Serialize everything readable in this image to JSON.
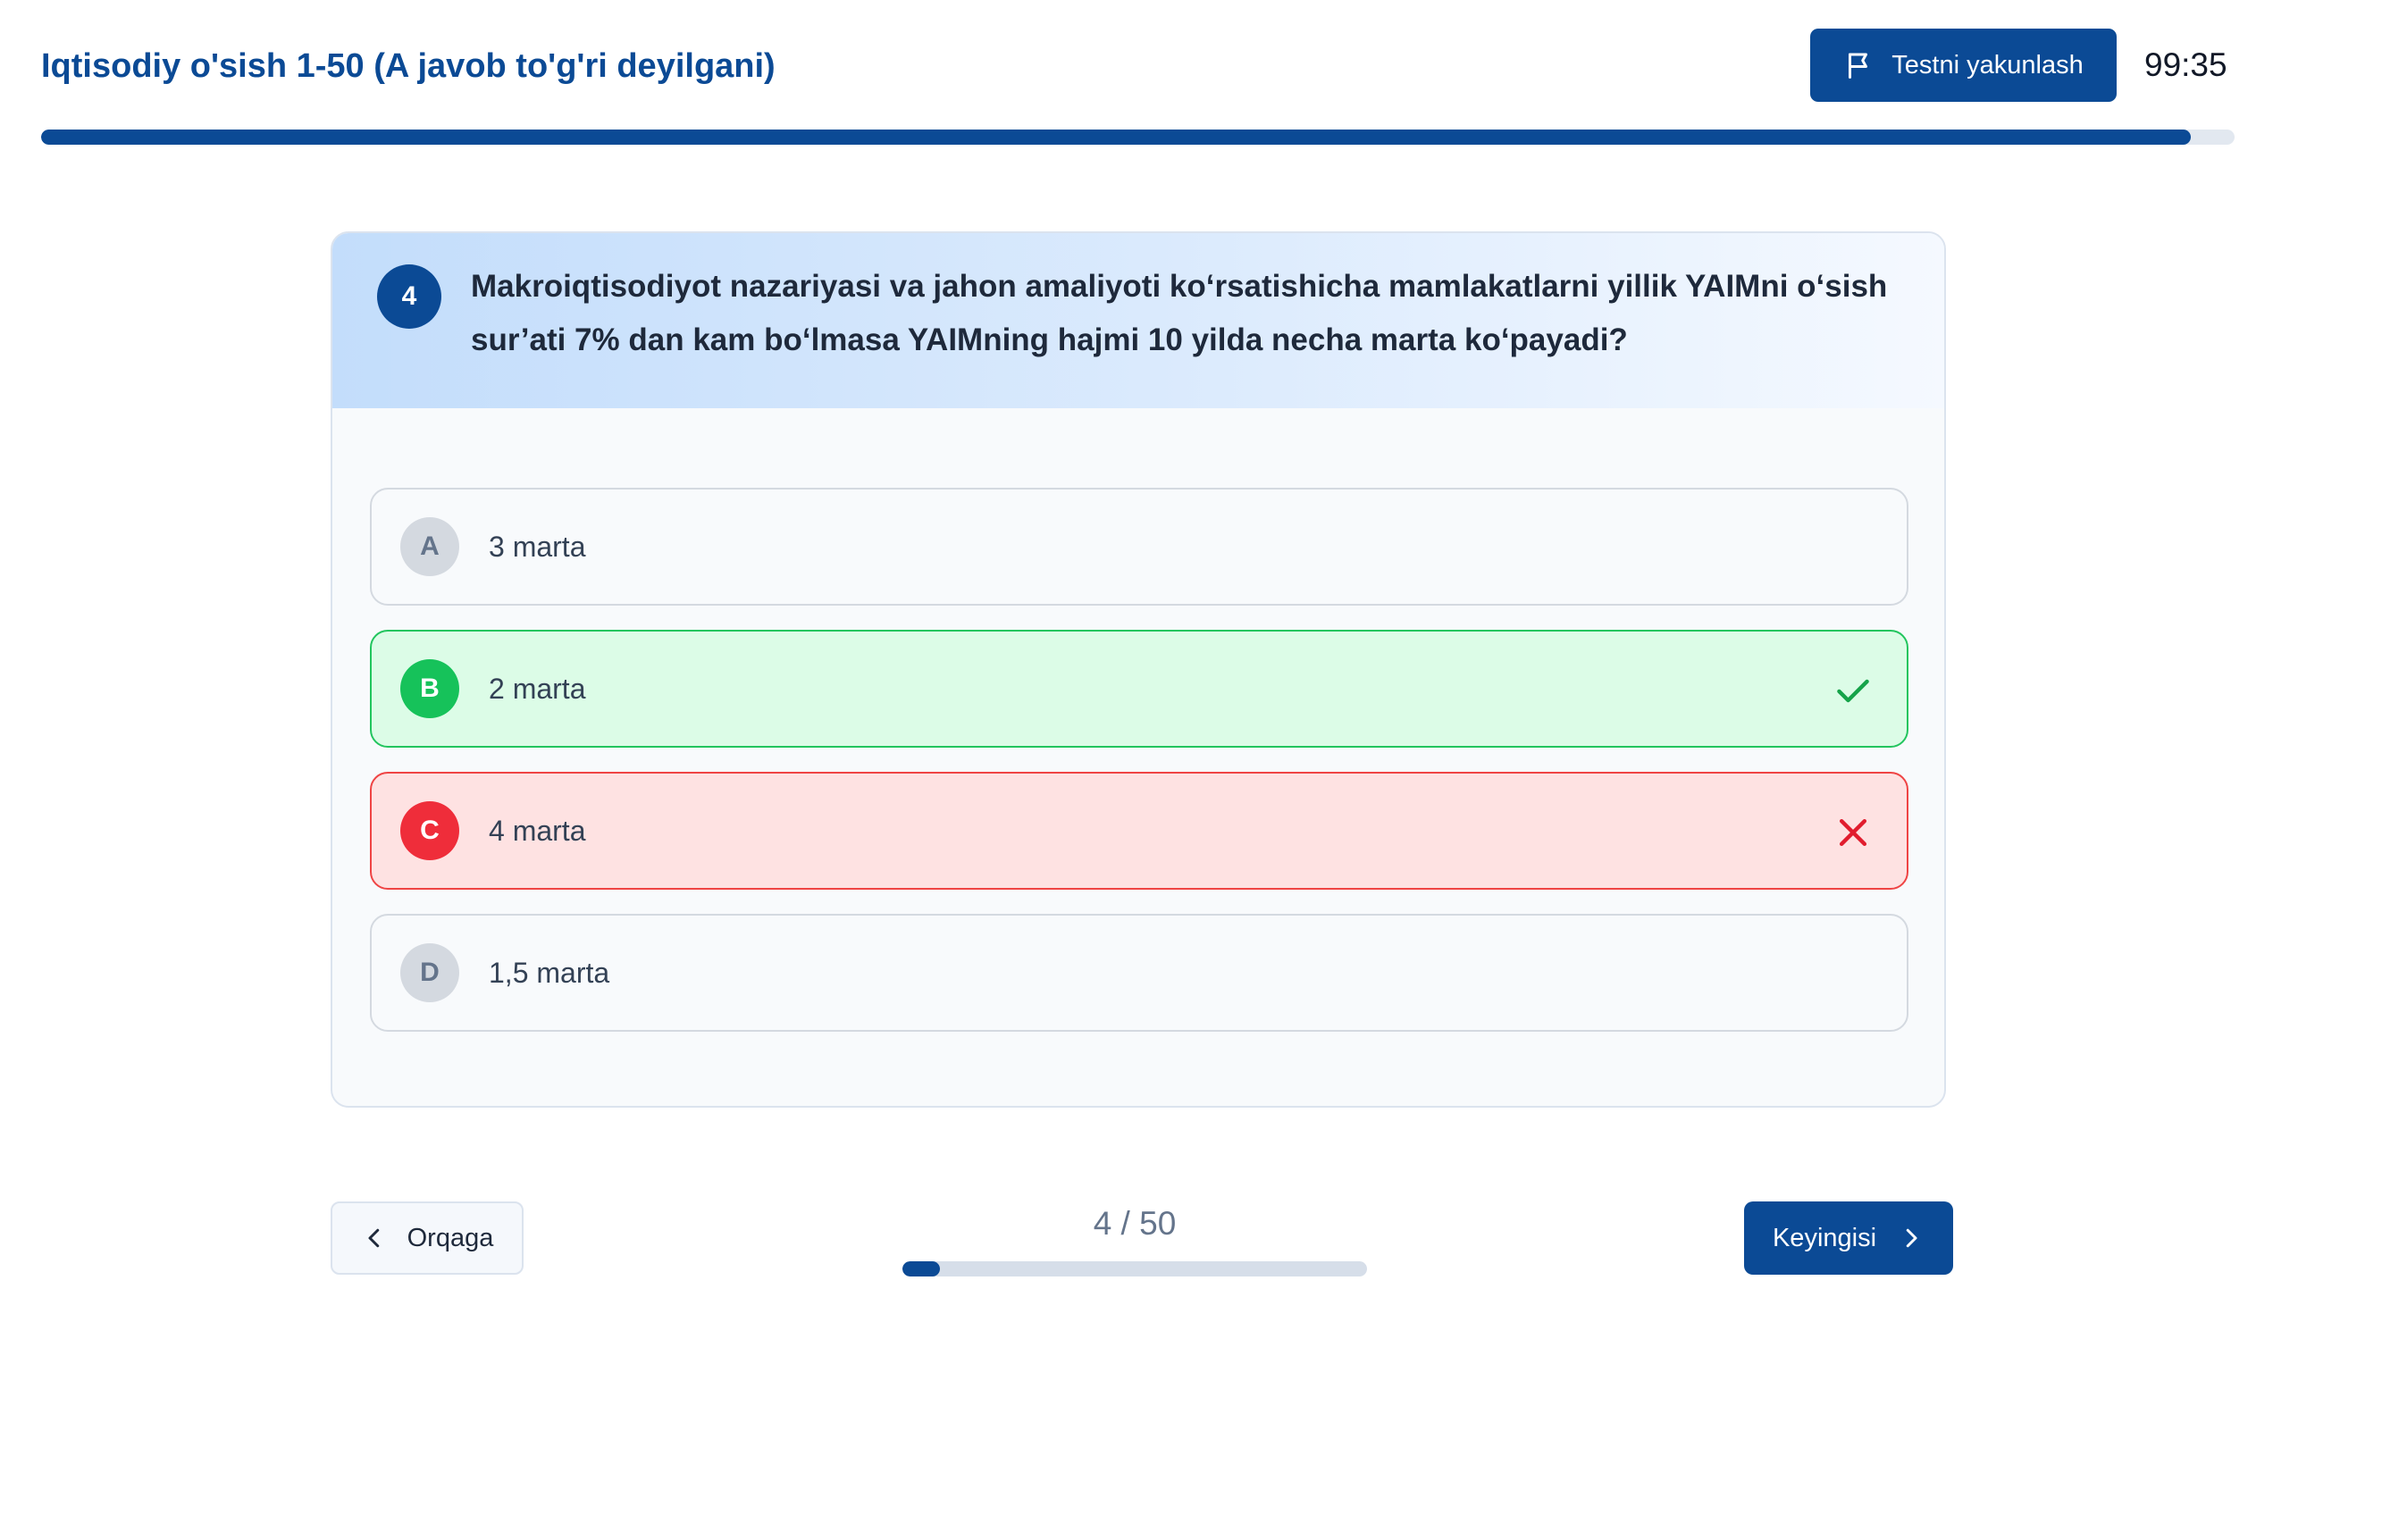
{
  "header": {
    "title": "Iqtisodiy o'sish 1-50 (A javob to'g'ri deyilgani)",
    "finish_button": "Testni yakunlash",
    "finish_icon": "flag-icon",
    "timer": "99:35",
    "progress_fraction": 0.98
  },
  "question": {
    "number": "4",
    "text": "Makroiqtisodiyot nazariyasi va jahon amaliyoti ko‘rsatishicha mamlakatlarni yillik YAIMni o‘sish sur’ati 7% dan kam bo‘lmasa YAIMning hajmi 10 yilda necha marta ko‘payadi?"
  },
  "options": [
    {
      "letter": "A",
      "text": "3 marta",
      "state": "neutral"
    },
    {
      "letter": "B",
      "text": "2 marta",
      "state": "correct",
      "icon": "check-icon"
    },
    {
      "letter": "C",
      "text": "4 marta",
      "state": "wrong",
      "icon": "x-icon"
    },
    {
      "letter": "D",
      "text": "1,5 marta",
      "state": "neutral"
    }
  ],
  "navigation": {
    "back_label": "Orqaga",
    "back_icon": "chevron-left-icon",
    "next_label": "Keyingisi",
    "next_icon": "chevron-right-icon",
    "counter": "4 / 50",
    "current": 4,
    "total": 50
  },
  "colors": {
    "primary": "#0b4a95",
    "correct": "#16c25a",
    "wrong": "#ef2d3a"
  }
}
